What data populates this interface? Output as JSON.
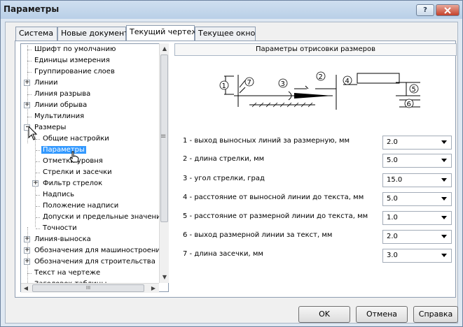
{
  "window": {
    "title": "Параметры",
    "help_label": "?"
  },
  "tabs": [
    "Система",
    "Новые документы",
    "Текущий чертеж",
    "Текущее окно"
  ],
  "tree": [
    {
      "label": "Шрифт по умолчанию",
      "level": 0,
      "expander": ""
    },
    {
      "label": "Единицы измерения",
      "level": 0,
      "expander": ""
    },
    {
      "label": "Группирование слоев",
      "level": 0,
      "expander": ""
    },
    {
      "label": "Линии",
      "level": 0,
      "expander": "+"
    },
    {
      "label": "Линия разрыва",
      "level": 0,
      "expander": ""
    },
    {
      "label": "Линии обрыва",
      "level": 0,
      "expander": "+"
    },
    {
      "label": "Мультилиния",
      "level": 0,
      "expander": ""
    },
    {
      "label": "Размеры",
      "level": 0,
      "expander": "-"
    },
    {
      "label": "Общие настройки",
      "level": 1,
      "expander": ""
    },
    {
      "label": "Параметры",
      "level": 1,
      "expander": "",
      "selected": true
    },
    {
      "label": "Отметки уровня",
      "level": 1,
      "expander": ""
    },
    {
      "label": "Стрелки и засечки",
      "level": 1,
      "expander": ""
    },
    {
      "label": "Фильтр стрелок",
      "level": 1,
      "expander": "+"
    },
    {
      "label": "Надпись",
      "level": 1,
      "expander": ""
    },
    {
      "label": "Положение надписи",
      "level": 1,
      "expander": ""
    },
    {
      "label": "Допуски и предельные значения",
      "level": 1,
      "expander": ""
    },
    {
      "label": "Точности",
      "level": 1,
      "expander": ""
    },
    {
      "label": "Линия-выноска",
      "level": 0,
      "expander": "+"
    },
    {
      "label": "Обозначения для машиностроения",
      "level": 0,
      "expander": "+"
    },
    {
      "label": "Обозначения для строительства",
      "level": 0,
      "expander": "+"
    },
    {
      "label": "Текст на чертеже",
      "level": 0,
      "expander": ""
    },
    {
      "label": "Заголовок таблицы",
      "level": 0,
      "expander": ""
    }
  ],
  "tree_scroll_grip": "≡",
  "hscroll_grip": "III",
  "header": "Параметры отрисовки размеров",
  "diagram_numbers": [
    "1",
    "2",
    "3",
    "4",
    "5",
    "6",
    "7"
  ],
  "params": [
    {
      "label": "1 - выход выносных линий за размерную, мм",
      "value": "2.0"
    },
    {
      "label": "2 - длина стрелки, мм",
      "value": "5.0"
    },
    {
      "label": "3 - угол стрелки, град",
      "value": "15.0"
    },
    {
      "label": "4 - расстояние от выносной линии до текста, мм",
      "value": "5.0"
    },
    {
      "label": "5 - расстояние от размерной линии до текста, мм",
      "value": "1.0"
    },
    {
      "label": "6 - выход размерной линии за текст, мм",
      "value": "2.0"
    },
    {
      "label": "7 - длина засечки, мм",
      "value": "3.0"
    }
  ],
  "buttons": {
    "ok": "OK",
    "cancel": "Отмена",
    "help": "Справка"
  }
}
